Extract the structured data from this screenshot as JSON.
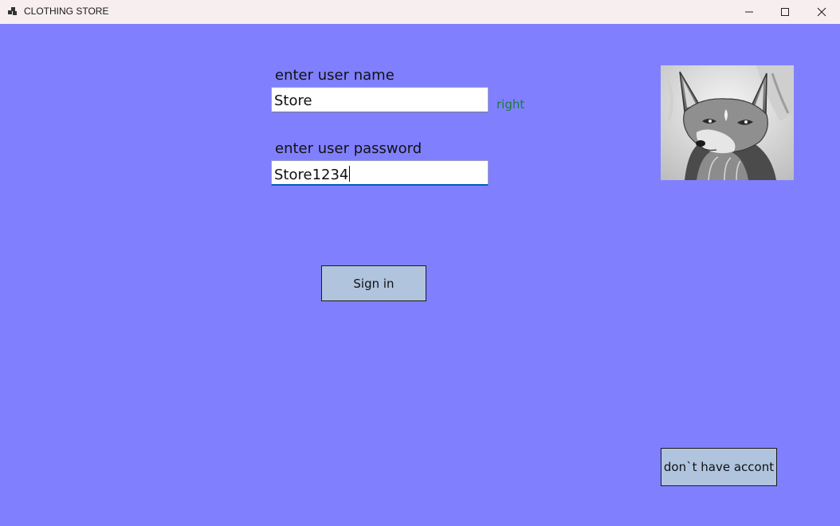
{
  "window": {
    "title": "CLOTHING STORE",
    "icon": "app-window-icon",
    "controls": [
      "minimize-icon",
      "maximize-icon",
      "close-icon"
    ]
  },
  "form": {
    "username_label": "enter user name",
    "username_value": "Store",
    "username_status": "right",
    "password_label": "enter user password",
    "password_value": "Store1234",
    "sign_in_label": "Sign in",
    "no_account_label": "don`t have accont"
  },
  "image": {
    "subject": "fox-illustration"
  },
  "colors": {
    "background": "#8080ff",
    "button": "#b0c4de",
    "status_ok": "#1e7a3c",
    "titlebar": "#f7efef"
  }
}
